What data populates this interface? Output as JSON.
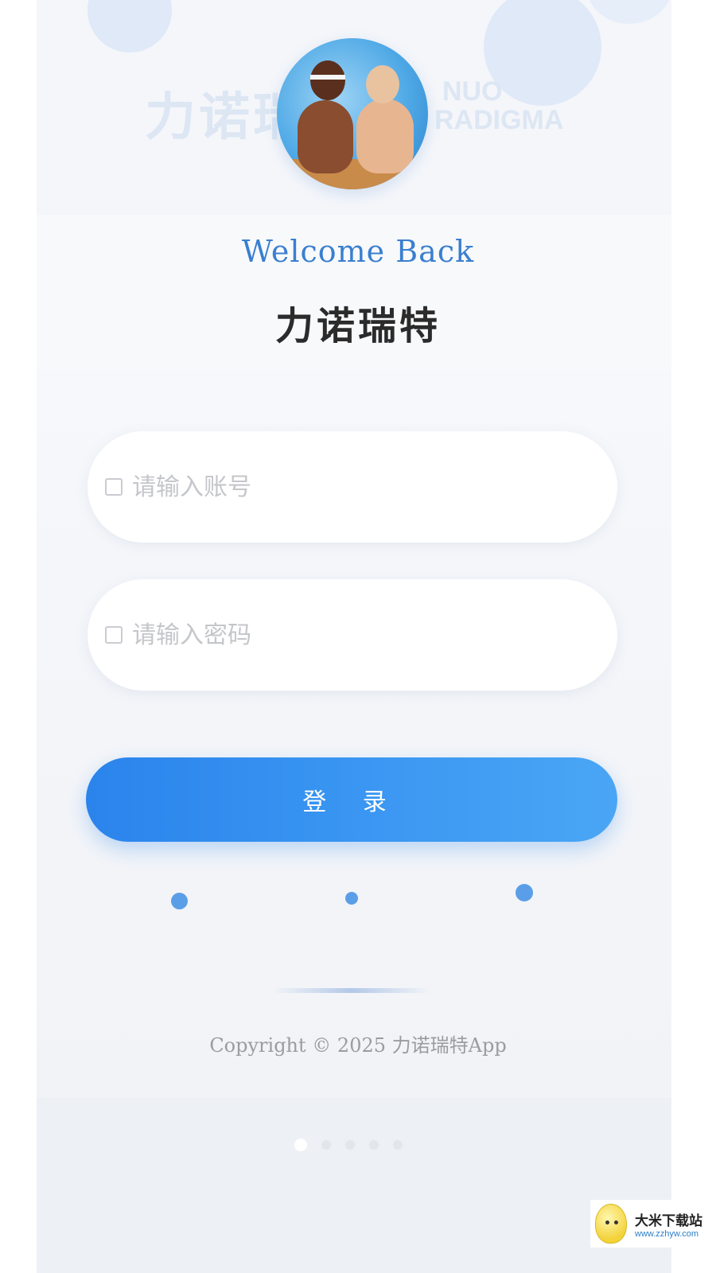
{
  "background": {
    "watermark_cn": "力诺瑞",
    "watermark_en_line1": "NUO",
    "watermark_en_line2": "RADIGMA"
  },
  "header": {
    "avatar_icon": "profile-photo",
    "welcome": "Welcome Back",
    "title": "力诺瑞特"
  },
  "form": {
    "account_placeholder": "请输入账号",
    "password_placeholder": "请输入密码",
    "login_label": "登 录"
  },
  "footer": {
    "copyright": "Copyright © 2025 力诺瑞特App",
    "page_count": 5,
    "active_page": 1
  },
  "badge": {
    "name": "大米下载站",
    "url": "www.zzhyw.com"
  },
  "colors": {
    "accent": "#2a84ec",
    "welcome_text": "#3a7fd0",
    "title_text": "#2b2b2b"
  }
}
